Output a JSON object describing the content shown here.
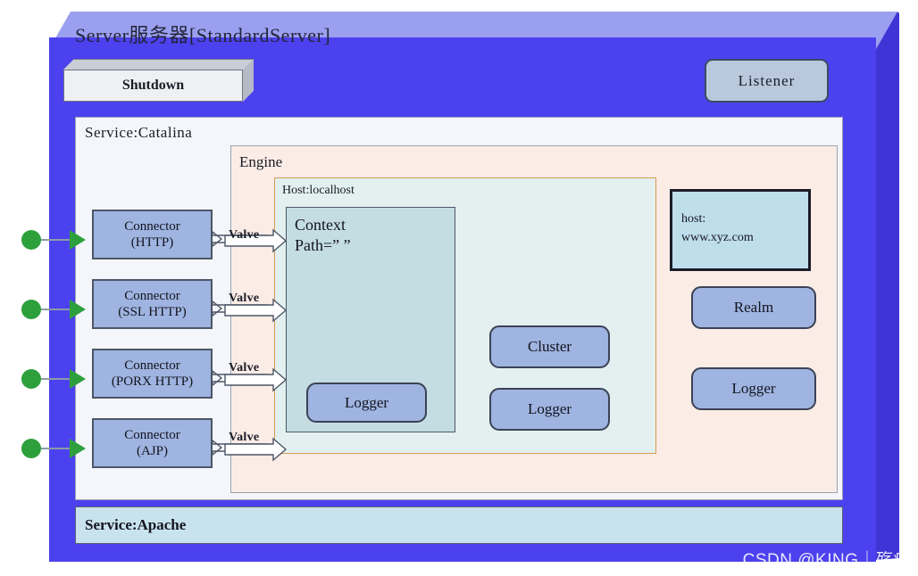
{
  "server": {
    "title": "Server服务器[StandardServer]",
    "shutdown_label": "Shutdown",
    "listener_label": "Listener",
    "box_color": "#4c41ee",
    "box_top_color": "#9aa0ef",
    "box_side_color": "#3f35d6"
  },
  "services": {
    "catalina_label": "Service:Catalina",
    "apache_label": "Service:Apache",
    "catalina_bg": "#f4f6fb",
    "apache_bg": "#c9e3ee"
  },
  "engine": {
    "label": "Engine",
    "bg": "#fbece6"
  },
  "host": {
    "label": "Host:localhost",
    "bg": "#e3f0f0",
    "border": "#d79a52"
  },
  "context": {
    "line1": "Context",
    "line2": "Path=” ”",
    "bg": "#c4dde3",
    "logger_label": "Logger"
  },
  "host_note": {
    "line1": "host:",
    "line2": "www.xyz.com",
    "bg": "#bfdeec"
  },
  "connectors": [
    {
      "line1": "Connector",
      "line2": "(HTTP)",
      "valve_label": "Valve"
    },
    {
      "line1": "Connector",
      "line2": "(SSL HTTP)",
      "valve_label": "Valve"
    },
    {
      "line1": "Connector",
      "line2": "(PORX HTTP)",
      "valve_label": "Valve"
    },
    {
      "line1": "Connector",
      "line2": "(AJP)",
      "valve_label": "Valve"
    }
  ],
  "host_children": {
    "cluster_label": "Cluster",
    "logger_label": "Logger"
  },
  "engine_children": {
    "realm_label": "Realm",
    "logger_label": "Logger"
  },
  "component_color": "#9fb4e0",
  "accent_green": "#2da03c",
  "watermark": "CSDN @KING｜殇痕"
}
